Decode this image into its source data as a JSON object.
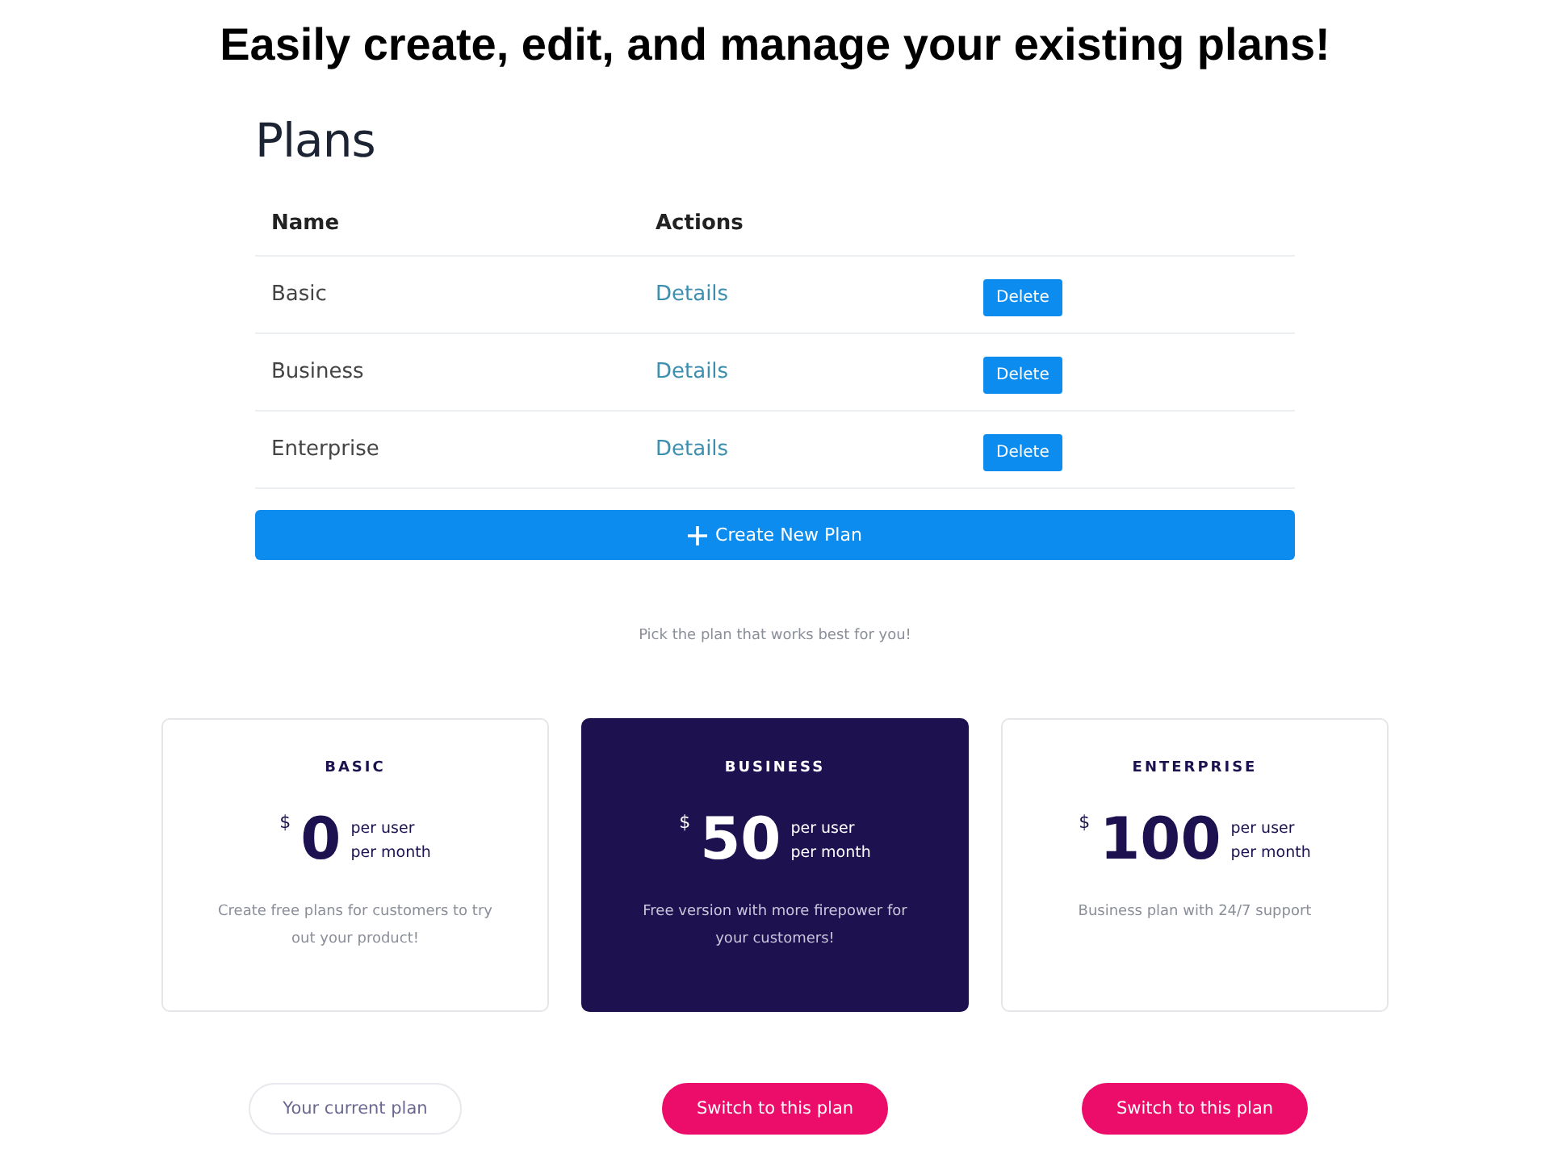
{
  "headline": "Easily create, edit, and manage your existing plans!",
  "plans_table": {
    "title": "Plans",
    "columns": [
      "Name",
      "Actions"
    ],
    "rows": [
      {
        "name": "Basic",
        "details": "Details",
        "delete": "Delete"
      },
      {
        "name": "Business",
        "details": "Details",
        "delete": "Delete"
      },
      {
        "name": "Enterprise",
        "details": "Details",
        "delete": "Delete"
      }
    ],
    "create_button": "Create New Plan"
  },
  "pricing": {
    "tagline": "Pick the plan that works best for you!",
    "cards": [
      {
        "name": "BASIC",
        "currency": "$",
        "price": "0",
        "unit_1": "per user",
        "unit_2": "per month",
        "description": "Create free plans for customers to try out your product!",
        "highlighted": false,
        "button": "Your current plan",
        "current": true
      },
      {
        "name": "BUSINESS",
        "currency": "$",
        "price": "50",
        "unit_1": "per user",
        "unit_2": "per month",
        "description": "Free version with more firepower for your customers!",
        "highlighted": true,
        "button": "Switch to this plan",
        "current": false
      },
      {
        "name": "ENTERPRISE",
        "currency": "$",
        "price": "100",
        "unit_1": "per user",
        "unit_2": "per month",
        "description": "Business plan with 24/7 support",
        "highlighted": false,
        "button": "Switch to this plan",
        "current": false
      }
    ]
  }
}
